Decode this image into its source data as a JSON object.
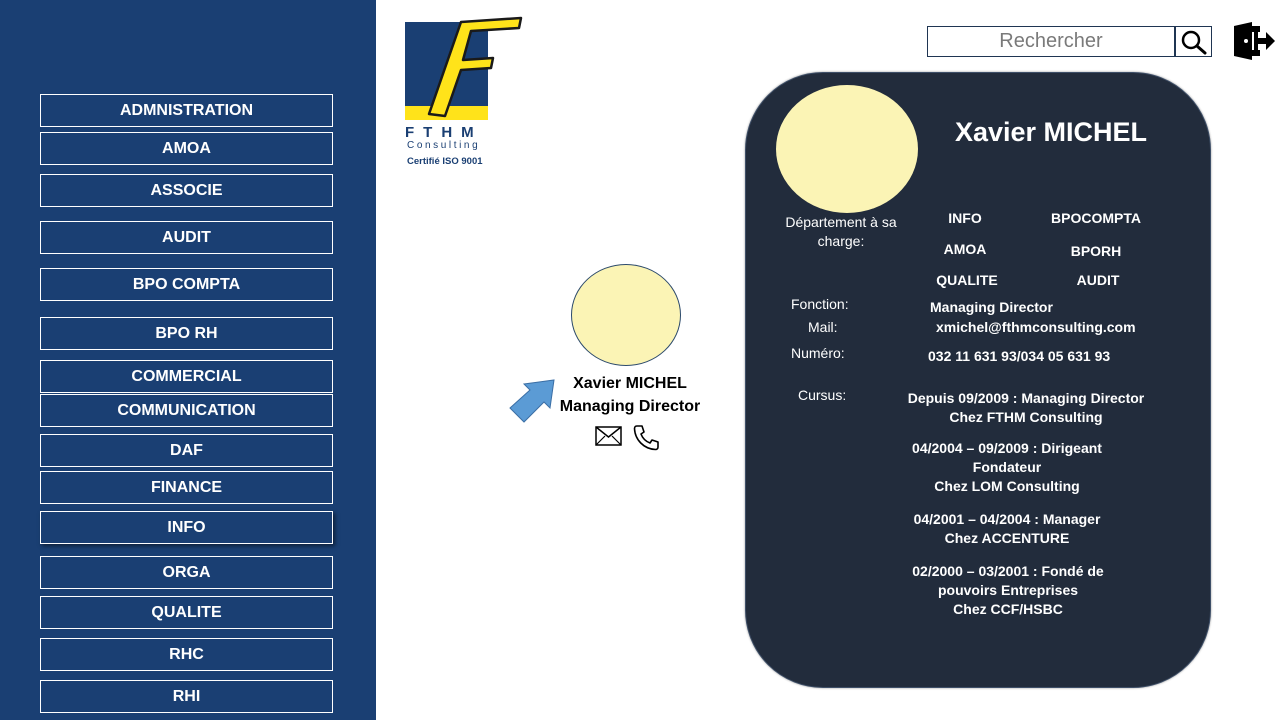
{
  "sidebar": {
    "items": [
      {
        "label": "ADMNISTRATION"
      },
      {
        "label": "AMOA"
      },
      {
        "label": "ASSOCIE"
      },
      {
        "label": "AUDIT"
      },
      {
        "label": "BPO COMPTA"
      },
      {
        "label": "BPO RH"
      },
      {
        "label": "COMMERCIAL"
      },
      {
        "label": "COMMUNICATION"
      },
      {
        "label": "DAF"
      },
      {
        "label": "FINANCE"
      },
      {
        "label": "INFO"
      },
      {
        "label": "ORGA"
      },
      {
        "label": "QUALITE"
      },
      {
        "label": "RHC"
      },
      {
        "label": "RHI"
      }
    ],
    "active": "INFO"
  },
  "logo": {
    "letters": "FTHM",
    "subtitle": "Consulting",
    "certification": "Certifié ISO 9001"
  },
  "search": {
    "placeholder": "Rechercher",
    "value": ""
  },
  "colors": {
    "sidebar": "#1a3f73",
    "card": "#222c3c",
    "avatar": "#fbf4b5",
    "arrow": "#5b9bd5"
  },
  "node": {
    "name": "Xavier MICHEL",
    "title": "Managing Director",
    "icons": [
      "mail-icon",
      "phone-icon"
    ]
  },
  "card": {
    "name": "Xavier MICHEL",
    "departments_label": "Département à sa charge:",
    "departments": [
      "INFO",
      "BPOCOMPTA",
      "AMOA",
      "BPORH",
      "QUALITE",
      "AUDIT"
    ],
    "fonction_label": "Fonction:",
    "fonction": "Managing Director",
    "mail_label": "Mail:",
    "mail": "xmichel@fthmconsulting.com",
    "numero_label": "Numéro:",
    "numero": "032 11 631 93/034 05 631 93",
    "cursus_label": "Cursus:",
    "cursus": [
      {
        "line1": "Depuis 09/2009 : Managing Director",
        "line2": "Chez FTHM Consulting"
      },
      {
        "line1": "04/2004 – 09/2009 : Dirigeant",
        "line2": "Fondateur",
        "line3": "Chez LOM Consulting"
      },
      {
        "line1": "04/2001 – 04/2004 : Manager",
        "line2": "Chez ACCENTURE"
      },
      {
        "line1": "02/2000 – 03/2001 : Fondé de",
        "line2": "pouvoirs Entreprises",
        "line3": "Chez CCF/HSBC"
      }
    ]
  }
}
